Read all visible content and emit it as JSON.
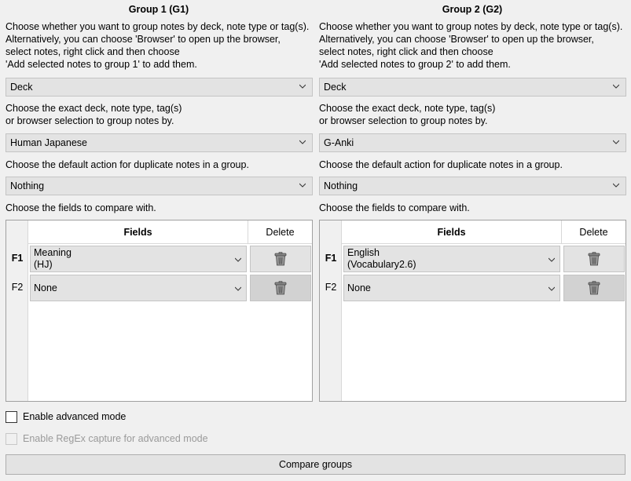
{
  "groups": [
    {
      "title": "Group 1 (G1)",
      "description": "Choose whether you want to group notes by deck, note type or tag(s).\nAlternatively, you can choose 'Browser' to open up the browser,\nselect notes, right click and then choose\n'Add selected notes to group 1' to add them.",
      "group_by_value": "Deck",
      "exact_label": "Choose the exact deck, note type, tag(s)\nor browser selection to group notes by.",
      "exact_value": "Human Japanese",
      "duplicate_label": "Choose the default action for duplicate notes in a group.",
      "duplicate_value": "Nothing",
      "fields_label": "Choose the fields to compare with.",
      "fields_header": "Fields",
      "delete_header": "Delete",
      "rows": [
        {
          "num": "F1",
          "field": "Meaning",
          "source": "(HJ)"
        },
        {
          "num": "F2",
          "field": "None",
          "source": ""
        }
      ]
    },
    {
      "title": "Group 2 (G2)",
      "description": "Choose whether you want to group notes by deck, note type or tag(s).\nAlternatively, you can choose 'Browser' to open up the browser,\nselect notes, right click and then choose\n'Add selected notes to group 2' to add them.",
      "group_by_value": "Deck",
      "exact_label": "Choose the exact deck, note type, tag(s)\nor browser selection to group notes by.",
      "exact_value": "G-Anki",
      "duplicate_label": "Choose the default action for duplicate notes in a group.",
      "duplicate_value": "Nothing",
      "fields_label": "Choose the fields to compare with.",
      "fields_header": "Fields",
      "delete_header": "Delete",
      "rows": [
        {
          "num": "F1",
          "field": "English",
          "source": "(Vocabulary2.6)"
        },
        {
          "num": "F2",
          "field": "None",
          "source": ""
        }
      ]
    }
  ],
  "advanced_mode_label": "Enable advanced mode",
  "advanced_mode_checked": false,
  "regex_label": "Enable RegEx capture for advanced mode",
  "regex_enabled": false,
  "compare_button_label": "Compare groups",
  "icons": {
    "dropdown": "chevron-down-icon",
    "delete": "trash-icon"
  }
}
